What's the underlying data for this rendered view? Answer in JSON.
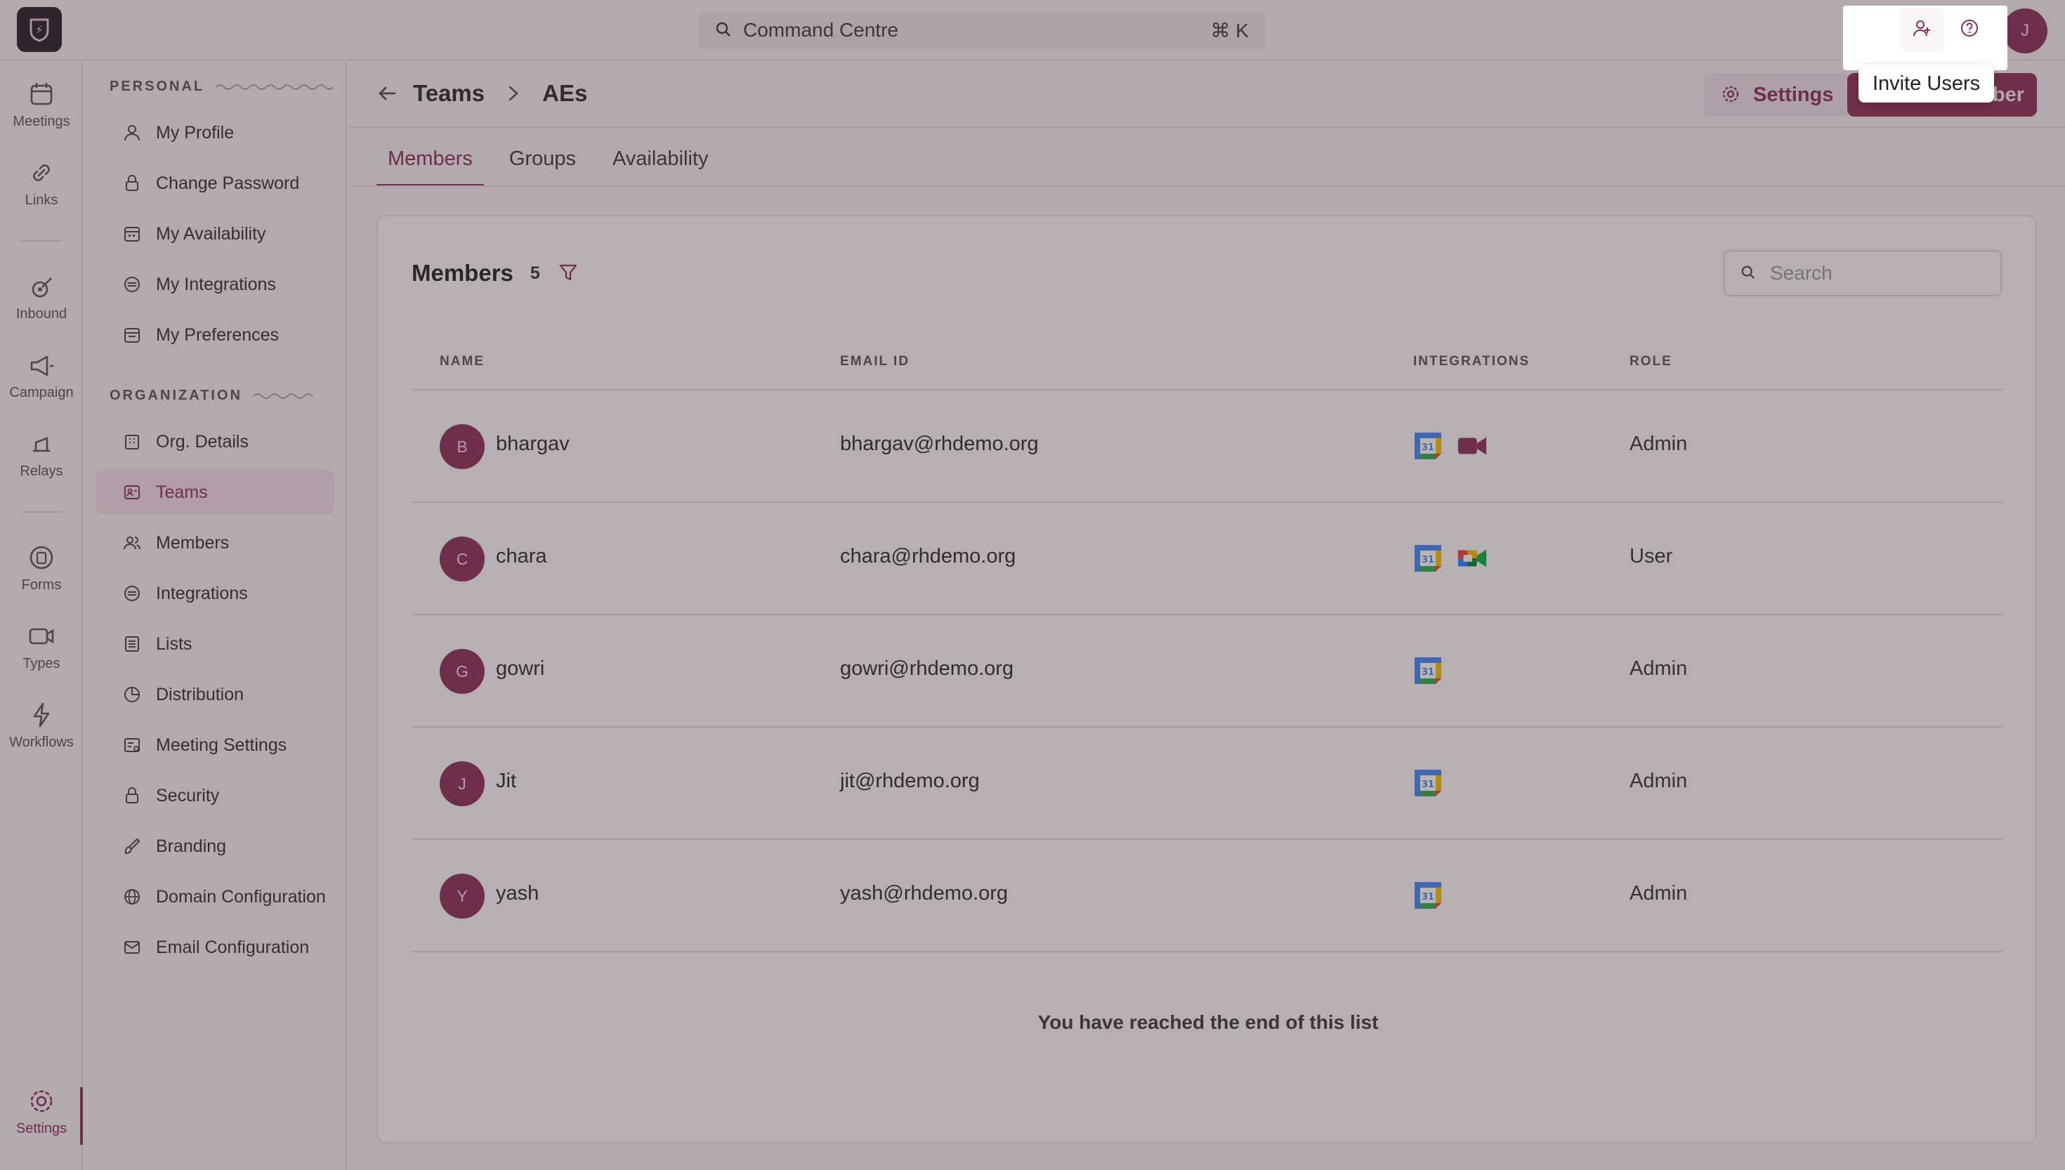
{
  "topbar": {
    "command_placeholder": "Command Centre",
    "command_shortcut": "⌘ K",
    "user_initial": "J",
    "tooltip": "Invite Users"
  },
  "rail": {
    "items": [
      {
        "label": "Meetings",
        "icon": "calendar-icon"
      },
      {
        "label": "Links",
        "icon": "link-icon"
      },
      {
        "label": "Inbound",
        "icon": "inbound-icon"
      },
      {
        "label": "Campaign",
        "icon": "megaphone-icon"
      },
      {
        "label": "Relays",
        "icon": "relay-icon"
      },
      {
        "label": "Forms",
        "icon": "form-icon"
      },
      {
        "label": "Types",
        "icon": "video-type-icon"
      },
      {
        "label": "Workflows",
        "icon": "lightning-icon"
      },
      {
        "label": "Settings",
        "icon": "gear-icon"
      }
    ]
  },
  "sidebar": {
    "personal_label": "PERSONAL",
    "organization_label": "ORGANIZATION",
    "personal_items": [
      {
        "label": "My Profile",
        "icon": "user-icon"
      },
      {
        "label": "Change Password",
        "icon": "lock-icon"
      },
      {
        "label": "My Availability",
        "icon": "calendar-grid-icon"
      },
      {
        "label": "My Integrations",
        "icon": "integration-icon"
      },
      {
        "label": "My Preferences",
        "icon": "preferences-icon"
      }
    ],
    "org_items": [
      {
        "label": "Org. Details",
        "icon": "building-icon"
      },
      {
        "label": "Teams",
        "icon": "team-card-icon"
      },
      {
        "label": "Members",
        "icon": "users-icon"
      },
      {
        "label": "Integrations",
        "icon": "integration-icon"
      },
      {
        "label": "Lists",
        "icon": "list-icon"
      },
      {
        "label": "Distribution",
        "icon": "pie-icon"
      },
      {
        "label": "Meeting Settings",
        "icon": "meeting-settings-icon"
      },
      {
        "label": "Security",
        "icon": "lock-icon"
      },
      {
        "label": "Branding",
        "icon": "brush-icon"
      },
      {
        "label": "Domain Configuration",
        "icon": "globe-icon"
      },
      {
        "label": "Email Configuration",
        "icon": "mail-icon"
      }
    ]
  },
  "header": {
    "crumb_parent": "Teams",
    "crumb_current": "AEs",
    "settings_label": "Settings",
    "add_label": "ber"
  },
  "tabs": [
    "Members",
    "Groups",
    "Availability"
  ],
  "members_card": {
    "title": "Members",
    "count": "5",
    "search_placeholder": "Search",
    "columns": [
      "NAME",
      "EMAIL ID",
      "INTEGRATIONS",
      "ROLE"
    ],
    "rows": [
      {
        "initial": "B",
        "name": "bhargav",
        "email": "bhargav@rhdemo.org",
        "integrations": [
          "google-calendar-icon",
          "zoom-video-icon"
        ],
        "role": "Admin"
      },
      {
        "initial": "C",
        "name": "chara",
        "email": "chara@rhdemo.org",
        "integrations": [
          "google-calendar-icon",
          "google-meet-icon"
        ],
        "role": "User"
      },
      {
        "initial": "G",
        "name": "gowri",
        "email": "gowri@rhdemo.org",
        "integrations": [
          "google-calendar-icon"
        ],
        "role": "Admin"
      },
      {
        "initial": "J",
        "name": "Jit",
        "email": "jit@rhdemo.org",
        "integrations": [
          "google-calendar-icon"
        ],
        "role": "Admin"
      },
      {
        "initial": "Y",
        "name": "yash",
        "email": "yash@rhdemo.org",
        "integrations": [
          "google-calendar-icon"
        ],
        "role": "Admin"
      }
    ],
    "end_note": "You have reached the end of this list"
  },
  "colors": {
    "brand": "#8b2c55",
    "background": "#f6eef1"
  }
}
